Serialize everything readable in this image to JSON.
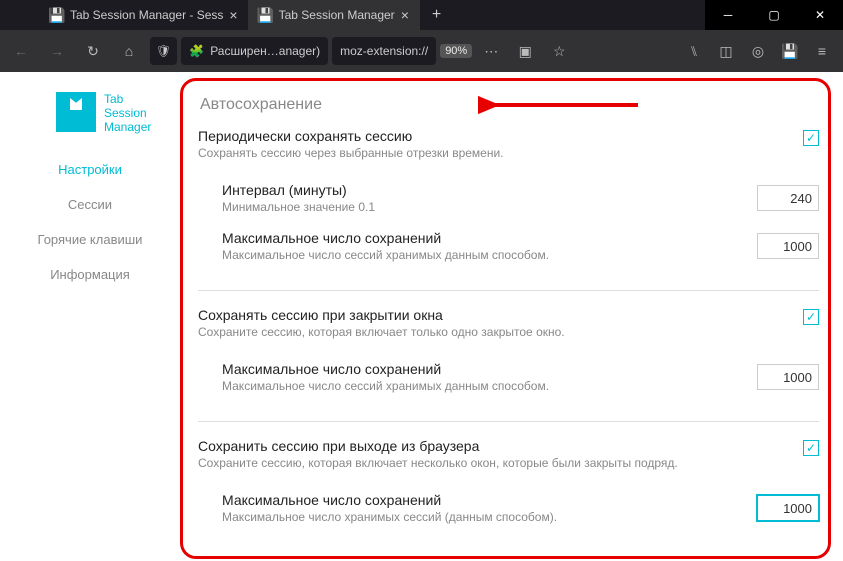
{
  "window": {
    "tabs": [
      {
        "title": "Tab Session Manager - Sess"
      },
      {
        "title": "Tab Session Manager"
      }
    ]
  },
  "toolbar": {
    "ext_label": "Расширен…anager)",
    "url": "moz-extension://",
    "zoom": "90%"
  },
  "app": {
    "name_l1": "Tab",
    "name_l2": "Session",
    "name_l3": "Manager",
    "nav": {
      "settings": "Настройки",
      "sessions": "Сессии",
      "hotkeys": "Горячие клавиши",
      "info": "Информация"
    }
  },
  "section": {
    "title": "Автосохранение",
    "periodic": {
      "label": "Периодически сохранять сессию",
      "desc": "Сохранять сессию через выбранные отрезки времени.",
      "interval": {
        "label": "Интервал (минуты)",
        "desc": "Минимальное значение 0.1",
        "value": "240"
      },
      "max": {
        "label": "Максимальное число сохранений",
        "desc": "Максимальное число сессий хранимых данным способом.",
        "value": "1000"
      }
    },
    "winclose": {
      "label": "Сохранять сессию при закрытии окна",
      "desc": "Сохраните сессию, которая включает только одно закрытое окно.",
      "max": {
        "label": "Максимальное число сохранений",
        "desc": "Максимальное число сессий хранимых данным способом.",
        "value": "1000"
      }
    },
    "browserexit": {
      "label": "Сохранить сессию при выходе из браузера",
      "desc": "Сохраните сессию, которая включает несколько окон, которые были закрыты подряд.",
      "max": {
        "label": "Максимальное число сохранений",
        "desc": "Максимальное число хранимых сессий (данным способом).",
        "value": "1000"
      }
    }
  }
}
